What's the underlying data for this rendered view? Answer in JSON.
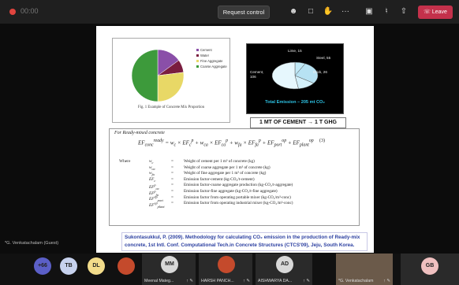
{
  "header": {
    "recording_label": "00:00",
    "request_control": "Request control",
    "leave": "Leave",
    "icons": [
      "people-icon",
      "chat-icon",
      "reactions-icon",
      "more-icon",
      "camera-icon",
      "mic-icon",
      "share-icon",
      "phone-icon"
    ],
    "more_glyph": "···"
  },
  "slide": {
    "pie_chart": {
      "caption": "Fig. 1 Example of Concrete Mix Proportion",
      "chart_data": {
        "type": "pie",
        "title": "",
        "categories": [
          "Cement",
          "Water",
          "Fine Aggregate",
          "Coarse Aggregate"
        ],
        "values": [
          15,
          8,
          27,
          50
        ],
        "colors": [
          "#8a4fa8",
          "#7a1d3f",
          "#e8d866",
          "#3d9a3b"
        ]
      }
    },
    "emission_chart": {
      "labels": [
        "Lime, 15",
        "Steel, 55",
        "Brick, 26",
        "Cement, 106"
      ],
      "total": "Total Emission – 205 mt CO₂",
      "chart_data": {
        "type": "pie",
        "title": "",
        "categories": [
          "Lime",
          "Steel",
          "Brick",
          "Cement"
        ],
        "values": [
          15,
          55,
          26,
          106
        ],
        "colors": [
          "#c0e9f7",
          "#b7e2f3",
          "#d3f0fa",
          "#e6f7fd"
        ]
      }
    },
    "ghg_banner": "1 MT OF CEMENT → 1 T GHG",
    "formula": {
      "heading": "For Ready-mixed concrete",
      "equation": "EF_conc^ready = w_c × EF_c^p + w_ca × EF_ca^p + w_fa × EF_fa^p + EF_port^op + EF_plant^op",
      "eq_number": "(3)",
      "where": "Where",
      "variables": [
        {
          "sym": "w_c",
          "def": "Weight of cement per 1 m³ of concrete (kg)"
        },
        {
          "sym": "w_ca",
          "def": "Weight of coarse aggregate per 1 m³ of concrete (kg)"
        },
        {
          "sym": "w_fa",
          "def": "Weight of fine aggregate per 1 m³ of concrete (kg)"
        },
        {
          "sym": "EF_c",
          "def": "Emission factor-cement (kg-CO₂/t-cement)"
        },
        {
          "sym": "EF_ca^p",
          "def": "Emission factor-coarse aggregate production (kg-CO₂/t-aggregate)"
        },
        {
          "sym": "EF_fa^p",
          "def": "Emission factor-fine aggregate (kg-CO₂/t-fine aggregate)"
        },
        {
          "sym": "EF_port^op",
          "def": "Emission factor from operating portable mixer (kg-CO₂/m³-conc)"
        },
        {
          "sym": "EF_plant^op",
          "def": "Emission factor from operating industrial mixer (kg-CO₂/m³-conc)"
        }
      ]
    },
    "citation": "Sukontasukkul, P. (2009). Methodology for calculating CO₂ emission in the production of Ready-mix concrete, 1st Intl. Conf. Computational Tech.in Concrete Structures (CTCS'09), Jeju, South Korea.",
    "guest_name": "*G. Venkatachalam (Guest)"
  },
  "participants": [
    {
      "initials": "+66",
      "color": "#5b5fc7"
    },
    {
      "initials": "TB",
      "color": "#c7d2ee"
    },
    {
      "initials": "DL",
      "color": "#f2dc8a"
    },
    {
      "initials": "",
      "color": "#c44a2c"
    }
  ],
  "tiles": [
    {
      "initials": "MM",
      "name": "Meenal Mateg..."
    },
    {
      "initials": "",
      "name": "HARSH PANCH..."
    },
    {
      "initials": "AD",
      "name": "AISHWARYA DA..."
    },
    {
      "initials": "",
      "name": "*G. Venkatachalam"
    },
    {
      "initials": "GB",
      "name": ""
    }
  ],
  "tile_icons": "↑ ✎"
}
